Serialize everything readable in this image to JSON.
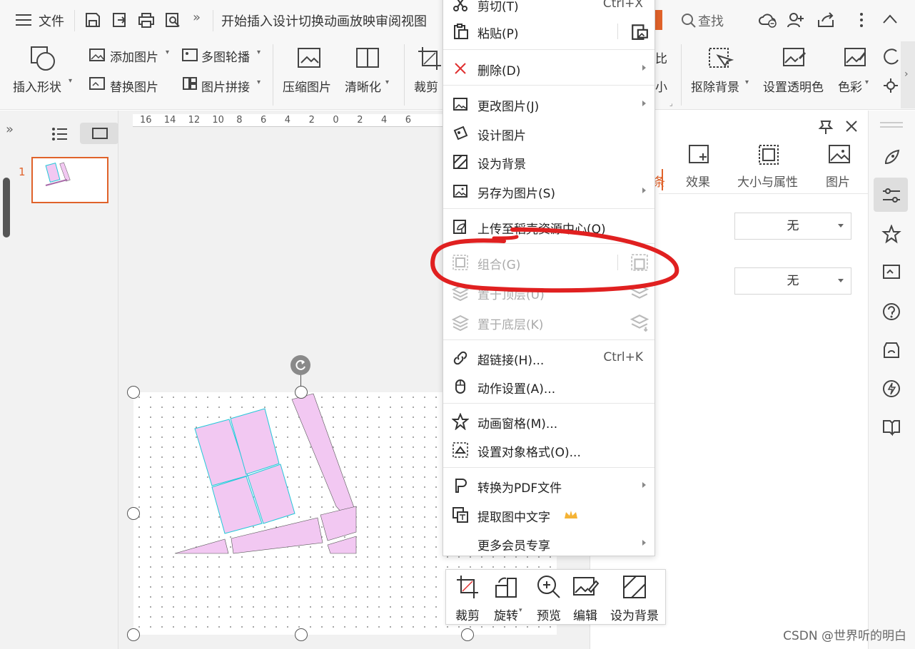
{
  "titlebar": {
    "file_menu": "文件",
    "menu_tabs": "开始插入设计切换动画放映审阅视图",
    "search_label": "查找",
    "more_indicator": "»"
  },
  "ribbon": {
    "insert_shape": "插入形状",
    "add_image": "添加图片",
    "replace_image": "替换图片",
    "multi_carousel": "多图轮播",
    "image_stitch": "图片拼接",
    "compress_image": "压缩图片",
    "sharpen": "清晰化",
    "crop": "裁剪",
    "contrast_partial": "比",
    "small_partial": "小",
    "remove_background": "抠除背景",
    "set_transparent": "设置透明色",
    "color": "色彩"
  },
  "slide_panel": {
    "slide_number": "1"
  },
  "ruler": {
    "ticks": [
      "16",
      "14",
      "12",
      "10",
      "8",
      "6",
      "4",
      "2",
      "0",
      "2",
      "4",
      "6"
    ]
  },
  "right_panel": {
    "tabs": [
      {
        "label": "条"
      },
      {
        "label": "效果"
      },
      {
        "label": "大小与属性"
      },
      {
        "label": "图片"
      }
    ],
    "dropdown1_value": "无",
    "dropdown2_value": "无"
  },
  "context_menu": {
    "items": [
      {
        "label": "剪切(T)",
        "shortcut": "Ctrl+X",
        "disabled": false
      },
      {
        "label": "粘贴(P)",
        "shortcut": "",
        "disabled": false
      },
      {
        "label": "删除(D)",
        "shortcut": "",
        "disabled": false
      },
      {
        "label": "更改图片(J)",
        "shortcut": "",
        "disabled": false
      },
      {
        "label": "设计图片",
        "shortcut": "",
        "disabled": false
      },
      {
        "label": "设为背景",
        "shortcut": "",
        "disabled": false
      },
      {
        "label": "另存为图片(S)",
        "shortcut": "",
        "disabled": false
      },
      {
        "label": "上传至稻壳资源中心(Q)",
        "shortcut": "",
        "disabled": false
      },
      {
        "label": "组合(G)",
        "shortcut": "",
        "disabled": true
      },
      {
        "label": "置于顶层(U)",
        "shortcut": "",
        "disabled": true
      },
      {
        "label": "置于底层(K)",
        "shortcut": "",
        "disabled": true
      },
      {
        "label": "超链接(H)...",
        "shortcut": "Ctrl+K",
        "disabled": false
      },
      {
        "label": "动作设置(A)...",
        "shortcut": "",
        "disabled": false
      },
      {
        "label": "动画窗格(M)...",
        "shortcut": "",
        "disabled": false
      },
      {
        "label": "设置对象格式(O)...",
        "shortcut": "",
        "disabled": false
      },
      {
        "label": "转换为PDF文件",
        "shortcut": "",
        "disabled": false
      },
      {
        "label": "提取图中文字",
        "shortcut": "",
        "disabled": false
      },
      {
        "label": "更多会员专享",
        "shortcut": "",
        "disabled": false
      }
    ]
  },
  "float_toolbar": {
    "crop": "裁剪",
    "rotate": "旋转",
    "preview": "预览",
    "edit": "编辑",
    "set_background": "设为背景"
  },
  "annotation_color": "#e02020",
  "accent_color": "#e0622a",
  "watermark": "CSDN @世界听的明白"
}
